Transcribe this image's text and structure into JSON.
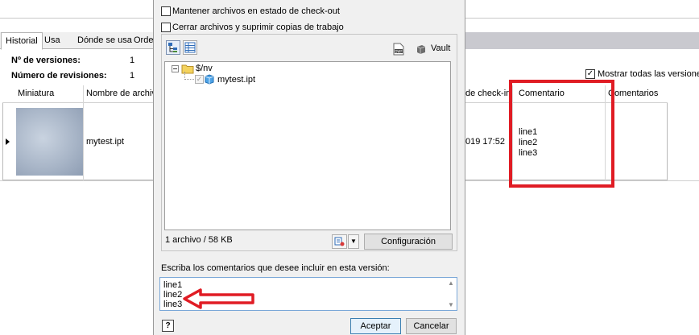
{
  "background": {
    "tabs": [
      "Historial",
      "Usa",
      "Dónde se usa",
      "Orde"
    ],
    "info": [
      {
        "label": "Nº de versiones:",
        "value": "1"
      },
      {
        "label": "Número de revisiones:",
        "value": "1"
      }
    ],
    "show_all_versions": {
      "label": "Mostrar todas las versiones",
      "checked": true
    },
    "grid": {
      "columns": [
        "Miniatura",
        "Nombre de archiv",
        "de check-in",
        "Comentario",
        "Comentarios"
      ],
      "row": {
        "file_name": "mytest.ipt",
        "checkin_date": "019 17:52",
        "comment": [
          "line1",
          "line2",
          "line3"
        ]
      }
    }
  },
  "dialog": {
    "options": [
      {
        "label": "Mantener archivos en estado de check-out",
        "checked": false
      },
      {
        "label": "Cerrar archivos y suprimir copias de trabajo",
        "checked": false
      }
    ],
    "vault_label": "Vault",
    "tree": {
      "root": "$/nv",
      "child": "mytest.ipt"
    },
    "file_summary": "1 archivo / 58 KB",
    "config_button": "Configuración",
    "comment_prompt": "Escriba los comentarios que desee incluir en esta versión:",
    "comment_lines": [
      "line1",
      "line2",
      "line3"
    ],
    "help_icon": "?",
    "accept_button": "Aceptar",
    "cancel_button": "Cancelar"
  },
  "colors": {
    "annotation_red": "#e01c24",
    "dialog_bg": "#f0f0f0",
    "accent_blue": "#3c7fb1"
  }
}
